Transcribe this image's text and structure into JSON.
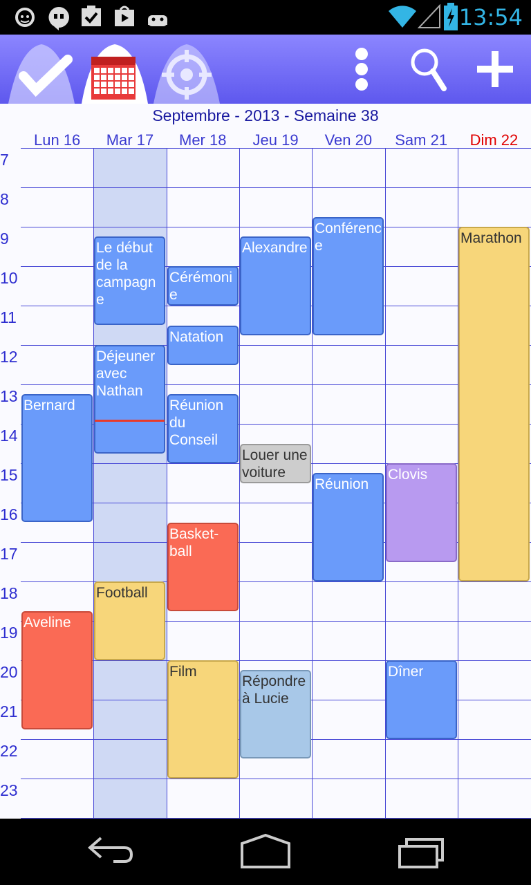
{
  "status_bar": {
    "time": "13:54",
    "icons": [
      "sync-icon",
      "hangouts-icon",
      "task-icon",
      "play-store-icon",
      "android-icon",
      "wifi-icon",
      "signal-icon",
      "battery-icon"
    ]
  },
  "toolbar": {
    "tabs": [
      "tasks-check-icon",
      "calendar-icon",
      "target-icon"
    ],
    "actions": [
      "overflow-menu-icon",
      "search-icon",
      "add-icon"
    ]
  },
  "calendar": {
    "title": "Septembre - 2013 - Semaine 38",
    "days": [
      {
        "label": "Lun 16",
        "sunday": false
      },
      {
        "label": "Mar 17",
        "sunday": false
      },
      {
        "label": "Mer 18",
        "sunday": false
      },
      {
        "label": "Jeu 19",
        "sunday": false
      },
      {
        "label": "Ven 20",
        "sunday": false
      },
      {
        "label": "Sam 21",
        "sunday": false
      },
      {
        "label": "Dim 22",
        "sunday": true
      }
    ],
    "today_index": 1,
    "hours": [
      "7",
      "8",
      "9",
      "10",
      "11",
      "12",
      "13",
      "14",
      "15",
      "16",
      "17",
      "18",
      "19",
      "20",
      "21",
      "22",
      "23"
    ],
    "events": [
      {
        "title": "Bernard",
        "day": 0,
        "start": 13.25,
        "end": 16.5,
        "color": "blue"
      },
      {
        "title": "Aveline",
        "day": 0,
        "start": 18.75,
        "end": 21.75,
        "color": "red"
      },
      {
        "title": "Le début de la campagne",
        "day": 1,
        "start": 9.25,
        "end": 11.5,
        "color": "blue"
      },
      {
        "title": "Déjeuner avec Nathan",
        "day": 1,
        "start": 12.0,
        "end": 14.75,
        "color": "blue"
      },
      {
        "title": "Football",
        "day": 1,
        "start": 18.0,
        "end": 20.0,
        "color": "yellow"
      },
      {
        "title": "Cérémonie",
        "day": 2,
        "start": 10.0,
        "end": 11.0,
        "color": "blue"
      },
      {
        "title": "Natation",
        "day": 2,
        "start": 11.5,
        "end": 12.5,
        "color": "blue"
      },
      {
        "title": "Réunion du Conseil",
        "day": 2,
        "start": 13.25,
        "end": 15.0,
        "color": "blue"
      },
      {
        "title": "Basket-ball",
        "day": 2,
        "start": 16.5,
        "end": 18.75,
        "color": "red"
      },
      {
        "title": "Film",
        "day": 2,
        "start": 20.0,
        "end": 23.0,
        "color": "yellow"
      },
      {
        "title": "Alexandre",
        "day": 3,
        "start": 9.25,
        "end": 11.75,
        "color": "blue"
      },
      {
        "title": "Louer une voiture",
        "day": 3,
        "start": 14.5,
        "end": 15.5,
        "color": "gray"
      },
      {
        "title": "Répondre à Lucie",
        "day": 3,
        "start": 20.25,
        "end": 22.5,
        "color": "lightblue"
      },
      {
        "title": "Conférence",
        "day": 4,
        "start": 8.75,
        "end": 11.75,
        "color": "blue"
      },
      {
        "title": "Réunion",
        "day": 4,
        "start": 15.25,
        "end": 18.0,
        "color": "blue"
      },
      {
        "title": "Clovis",
        "day": 5,
        "start": 15.0,
        "end": 17.5,
        "color": "purple"
      },
      {
        "title": "Dîner",
        "day": 5,
        "start": 20.0,
        "end": 22.0,
        "color": "blue"
      },
      {
        "title": "Marathon",
        "day": 6,
        "start": 9.0,
        "end": 18.0,
        "color": "yellow"
      }
    ],
    "current_time": {
      "day": 1,
      "hour": 13.9
    }
  },
  "nav_bar": {
    "buttons": [
      "back-icon",
      "home-icon",
      "recent-apps-icon"
    ]
  }
}
